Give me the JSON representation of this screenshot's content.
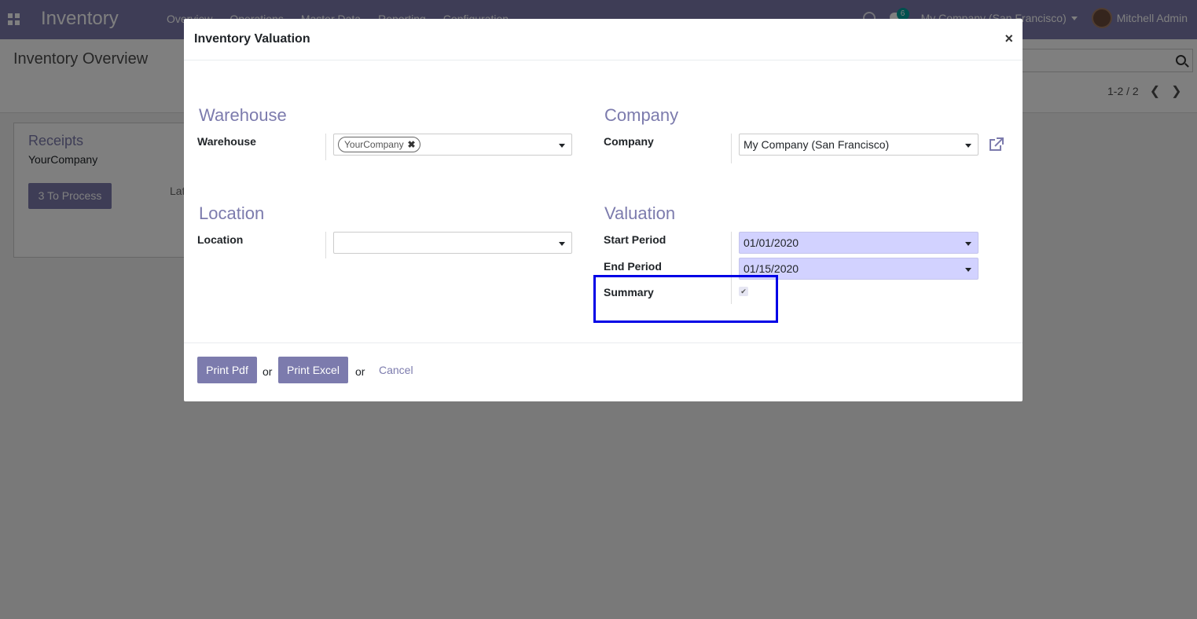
{
  "navbar": {
    "app_name": "Inventory",
    "menu": [
      "Overview",
      "Operations",
      "Master Data",
      "Reporting",
      "Configuration"
    ],
    "chat_count": "6",
    "company": "My Company (San Francisco)",
    "user": "Mitchell Admin"
  },
  "control_panel": {
    "title": "Inventory Overview",
    "pager": "1-2 / 2"
  },
  "kanban": {
    "card_title": "Receipts",
    "card_subtitle": "YourCompany",
    "process_button": "3 To Process",
    "late_label": "Late"
  },
  "modal": {
    "title": "Inventory Valuation",
    "close": "×",
    "warehouse_section": "Warehouse",
    "warehouse_label": "Warehouse",
    "warehouse_tag": "YourCompany",
    "company_section": "Company",
    "company_label": "Company",
    "company_value": "My Company (San Francisco)",
    "location_section": "Location",
    "location_label": "Location",
    "location_value": "",
    "valuation_section": "Valuation",
    "start_period_label": "Start Period",
    "start_period_value": "01/01/2020",
    "end_period_label": "End Period",
    "end_period_value": "01/15/2020",
    "summary_label": "Summary",
    "summary_checked": true,
    "highlight_color": "#0000e6",
    "footer": {
      "print_pdf": "Print Pdf",
      "or1": "or",
      "print_excel": "Print Excel",
      "or2": "or",
      "cancel": "Cancel"
    }
  },
  "colors": {
    "brand": "#7c7bad",
    "date_field_bg": "#d2d2ff"
  }
}
